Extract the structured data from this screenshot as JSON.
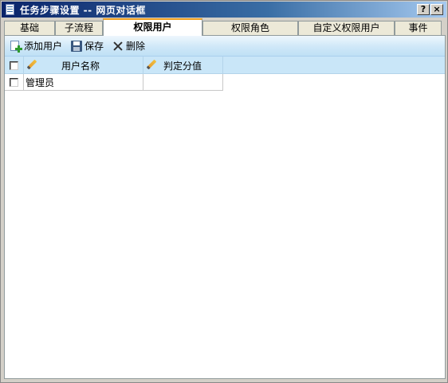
{
  "window": {
    "title": "任务步骤设置 -- 网页对话框",
    "help_glyph": "?",
    "close_glyph": "×"
  },
  "tabs": [
    {
      "label": "基础",
      "active": false
    },
    {
      "label": "子流程",
      "active": false
    },
    {
      "label": "权限用户",
      "active": true
    },
    {
      "label": "权限角色",
      "active": false
    },
    {
      "label": "自定义权限用户",
      "active": false
    },
    {
      "label": "事件",
      "active": false
    }
  ],
  "toolbar": {
    "add_label": "添加用户",
    "save_label": "保存",
    "delete_label": "删除"
  },
  "grid": {
    "columns": [
      "用户名称",
      "判定分值"
    ],
    "rows": [
      {
        "name": "管理员",
        "score": ""
      }
    ]
  },
  "colors": {
    "title_gradient_start": "#0a246a",
    "title_gradient_end": "#a6caf0",
    "active_tab_accent": "#f0a020",
    "toolbar_bg": "#cfe8f8",
    "grid_header_bg": "#c9e6f8"
  }
}
